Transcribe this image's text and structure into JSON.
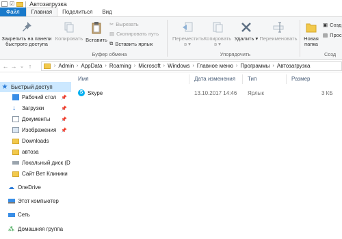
{
  "window": {
    "title": "Автозагрузка"
  },
  "tabs": [
    "Файл",
    "Главная",
    "Поделиться",
    "Вид"
  ],
  "ribbon": {
    "pin_label_1": "Закрепить на панели",
    "pin_label_2": "быстрого доступа",
    "copy_label": "Копировать",
    "paste_label": "Вставить",
    "cut_label": "Вырезать",
    "copy_path_label": "Скопировать путь",
    "paste_shortcut_label": "Вставить ярлык",
    "move_to_label_1": "Переместить",
    "move_to_label_2": "в ▾",
    "copy_to_label_1": "Копировать",
    "copy_to_label_2": "в ▾",
    "delete_label": "Удалить ▾",
    "rename_label": "Переименовать",
    "new_folder_label_1": "Новая",
    "new_folder_label_2": "папка",
    "create_label": "Созд",
    "easy_access_label": "Прос",
    "group_clipboard": "Буфер обмена",
    "group_organize": "Упорядочить",
    "group_new": "Созд"
  },
  "address": {
    "crumbs": [
      "Admin",
      "AppData",
      "Roaming",
      "Microsoft",
      "Windows",
      "Главное меню",
      "Программы",
      "Автозагрузка"
    ]
  },
  "sidebar": {
    "items": [
      {
        "label": "Быстрый доступ"
      },
      {
        "label": "Рабочий стол"
      },
      {
        "label": "Загрузки"
      },
      {
        "label": "Документы"
      },
      {
        "label": "Изображения"
      },
      {
        "label": "Downloads"
      },
      {
        "label": "автоза"
      },
      {
        "label": "Локальный диск (D"
      },
      {
        "label": "Сайт Вет Клиники"
      },
      {
        "label": "OneDrive"
      },
      {
        "label": "Этот компьютер"
      },
      {
        "label": "Сеть"
      },
      {
        "label": "Домашняя группа"
      }
    ]
  },
  "table": {
    "columns": [
      "Имя",
      "Дата изменения",
      "Тип",
      "Размер"
    ],
    "rows": [
      {
        "name": "Skype",
        "date": "13.10.2017 14:46",
        "type": "Ярлык",
        "size": "3 КБ"
      }
    ]
  },
  "colors": {
    "accent": "#1979ca",
    "selection": "#cce8ff",
    "folder": "#f2c94c",
    "skype": "#00aff0"
  }
}
